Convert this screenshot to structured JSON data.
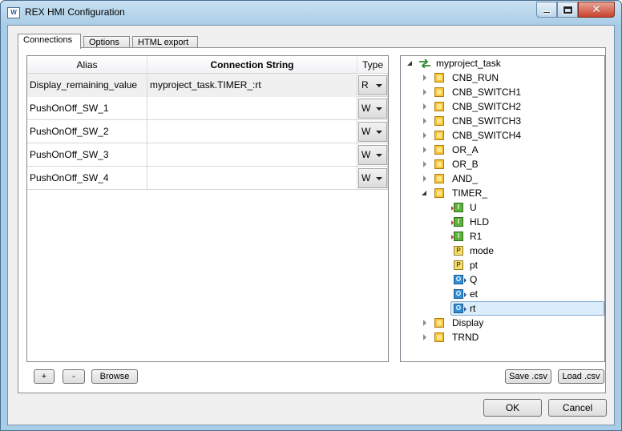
{
  "window": {
    "title": "REX HMI Configuration",
    "icon_text": "W"
  },
  "tabs": [
    {
      "label": "Connections"
    },
    {
      "label": "Options"
    },
    {
      "label": "HTML export"
    }
  ],
  "table": {
    "headers": {
      "alias": "Alias",
      "connection": "Connection String",
      "type": "Type"
    },
    "rows": [
      {
        "alias": "Display_remaining_value",
        "connection": "myproject_task.TIMER_:rt",
        "type": "R"
      },
      {
        "alias": "PushOnOff_SW_1",
        "connection": "",
        "type": "W"
      },
      {
        "alias": "PushOnOff_SW_2",
        "connection": "",
        "type": "W"
      },
      {
        "alias": "PushOnOff_SW_3",
        "connection": "",
        "type": "W"
      },
      {
        "alias": "PushOnOff_SW_4",
        "connection": "",
        "type": "W"
      }
    ]
  },
  "tree": {
    "root": "myproject_task",
    "blocks_before": [
      "CNB_RUN",
      "CNB_SWITCH1",
      "CNB_SWITCH2",
      "CNB_SWITCH3",
      "CNB_SWITCH4",
      "OR_A",
      "OR_B",
      "AND_"
    ],
    "expanded_block": "TIMER_",
    "pins": [
      {
        "kind": "input",
        "icon_text": "I",
        "label": "U"
      },
      {
        "kind": "input",
        "icon_text": "I",
        "label": "HLD"
      },
      {
        "kind": "input",
        "icon_text": "I",
        "label": "R1"
      },
      {
        "kind": "parameter",
        "icon_text": "P",
        "label": "mode"
      },
      {
        "kind": "parameter",
        "icon_text": "P",
        "label": "pt"
      },
      {
        "kind": "output",
        "icon_text": "O",
        "label": "Q"
      },
      {
        "kind": "output",
        "icon_text": "O",
        "label": "et"
      },
      {
        "kind": "output",
        "icon_text": "O",
        "label": "rt"
      }
    ],
    "selected": "rt",
    "blocks_after": [
      "Display",
      "TRND"
    ]
  },
  "buttons": {
    "add": "+",
    "remove": "-",
    "browse": "Browse",
    "save_csv": "Save .csv",
    "load_csv": "Load .csv",
    "ok": "OK",
    "cancel": "Cancel"
  }
}
